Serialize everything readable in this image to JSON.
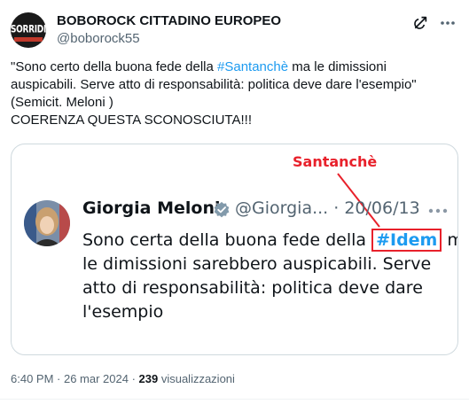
{
  "author": {
    "display_name": "BOBOROCK CITTADINO EUROPEO",
    "handle": "@boborock55",
    "avatar_text": "SORRIDI"
  },
  "tweet": {
    "line1_before": "\"Sono certo della buona fede della ",
    "line1_hashtag": "#Santanchè",
    "line1_after": " ma le dimissioni",
    "line2": "auspicabili. Serve atto di responsabilità: politica deve dare l'esempio\"",
    "line3": "(Semicit. Meloni )",
    "line4": "COERENZA QUESTA SCONOSCIUTA!!!"
  },
  "embedded": {
    "annotation": "Santanchè",
    "name": "Giorgia Meloni",
    "meta": "@Giorgia... · 20/06/13",
    "line1_before": "Sono certa della buona fede della ",
    "line1_hashtag": "#Idem",
    "line1_after": " ma",
    "line2": "le dimissioni sarebbero auspicabili. Serve",
    "line3": "atto di responsabilità: politica deve dare",
    "line4": "l'esempio"
  },
  "footer": {
    "time": "6:40 PM · 26 mar 2024 · ",
    "views_count": "239",
    "views_label": " visualizzazioni"
  },
  "colors": {
    "accent": "#1d9bf0",
    "annotation_red": "#e8212b",
    "secondary_text": "#536471"
  },
  "icons": {
    "header": [
      "grok-icon",
      "more-options-icon"
    ],
    "embedded": [
      "verified-badge-icon",
      "more-options-icon"
    ]
  }
}
